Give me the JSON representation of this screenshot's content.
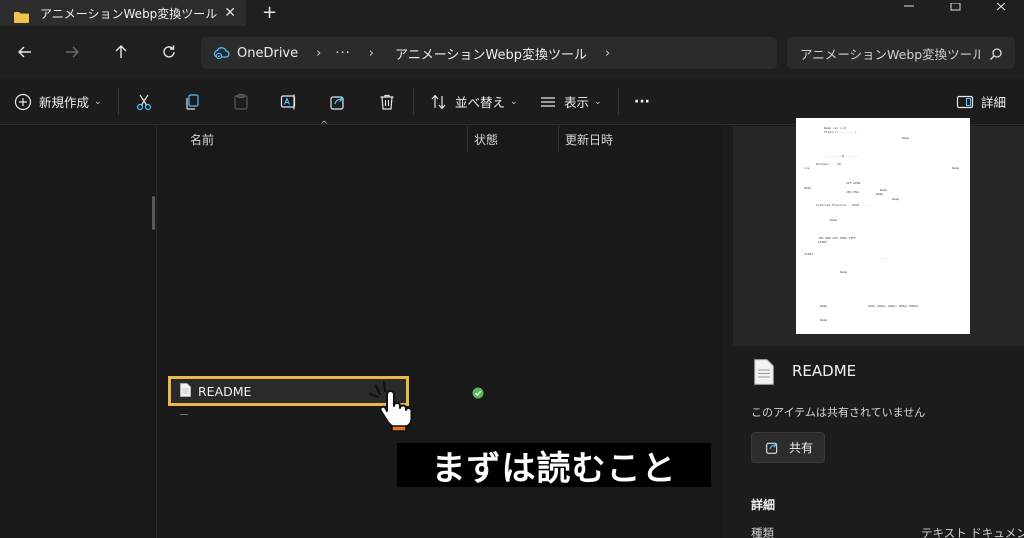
{
  "window": {
    "tab_title": "アニメーションWebp変換ツール",
    "new_tab": "+",
    "tab_close": "✕"
  },
  "address": {
    "root": "OneDrive",
    "overflow": "···",
    "folder": "アニメーションWebp変換ツール",
    "chevron": "›"
  },
  "search": {
    "placeholder": "アニメーションWebp変換ツールの検索"
  },
  "toolbar": {
    "new_label": "新規作成",
    "sort_label": "並べ替え",
    "view_label": "表示",
    "more_label": "···",
    "details_label": "詳細"
  },
  "columns": {
    "name": "名前",
    "status": "状態",
    "modified": "更新日時"
  },
  "files": [
    {
      "name": "README",
      "status": "synced"
    }
  ],
  "caption": "まずは読むこと",
  "details": {
    "file_name": "README",
    "share_info": "このアイテムは共有されていません",
    "share_button": "共有",
    "section_header": "詳細",
    "kind_label": "種類",
    "kind_value": "テキスト ドキュメント"
  },
  "colors": {
    "highlight_border": "#e8b84a",
    "sync_ok": "#5cb85c",
    "accent": "#4cc2ff"
  }
}
